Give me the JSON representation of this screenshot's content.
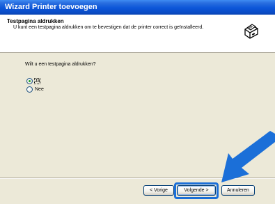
{
  "window": {
    "title": "Wizard Printer toevoegen"
  },
  "header": {
    "title": "Testpagina aldrukken",
    "subtitle": "U kunt een testpagina aldrukken om te bevestigen dat de printer correct is geïnstalleerd."
  },
  "body": {
    "question": "Wilt u een testpagina aldrukken?",
    "options": [
      {
        "label": "Ja",
        "selected": true
      },
      {
        "label": "Nee",
        "selected": false
      }
    ]
  },
  "buttons": {
    "back": "< Vorige",
    "next": "Volgende >",
    "cancel": "Annuleren"
  },
  "colors": {
    "annotation_arrow": "#1b6fd8"
  },
  "icons": {
    "header_icon": "printer-icon",
    "callout": "arrow-pointer-icon"
  }
}
